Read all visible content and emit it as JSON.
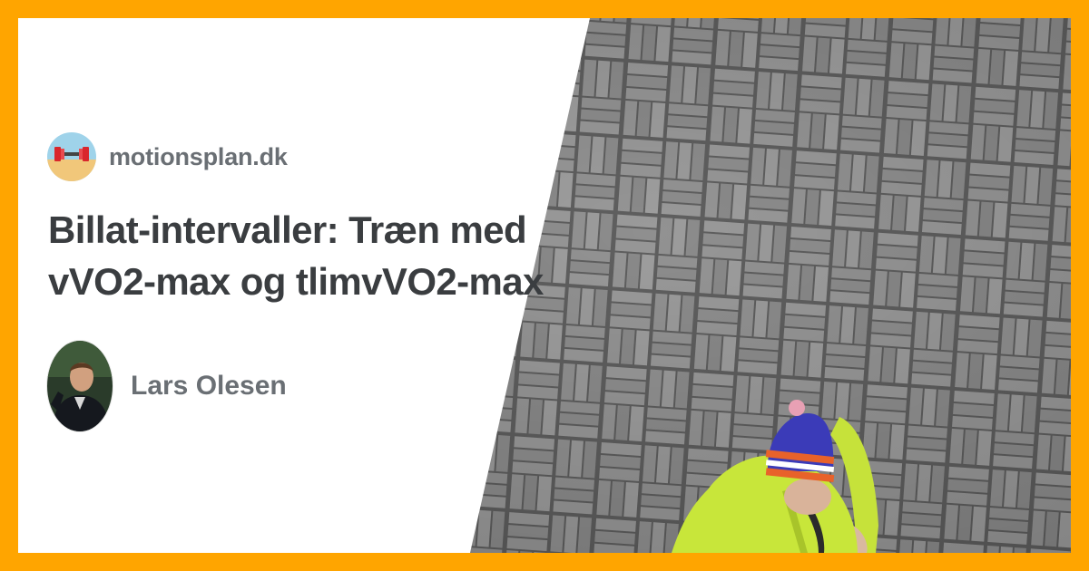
{
  "site": {
    "name": "motionsplan.dk",
    "logo_icon": "dumbbell-beach-icon"
  },
  "article": {
    "title_line_1": "Billat-intervaller: Træn med",
    "title_line_2": "vVO2-max og tlimvVO2-max"
  },
  "author": {
    "name": "Lars Olesen",
    "avatar_icon": "author-portrait-photo"
  },
  "hero_image": {
    "subject": "runner-on-paving-stones-photo"
  },
  "colors": {
    "frame": "#ffa500",
    "card": "#ffffff",
    "title": "#3a3d40",
    "meta": "#6a6f74",
    "paving": "#8e8e8e",
    "jacket": "#c8e63a",
    "hat_blue": "#3b3bb8",
    "hat_orange": "#e8622a"
  }
}
